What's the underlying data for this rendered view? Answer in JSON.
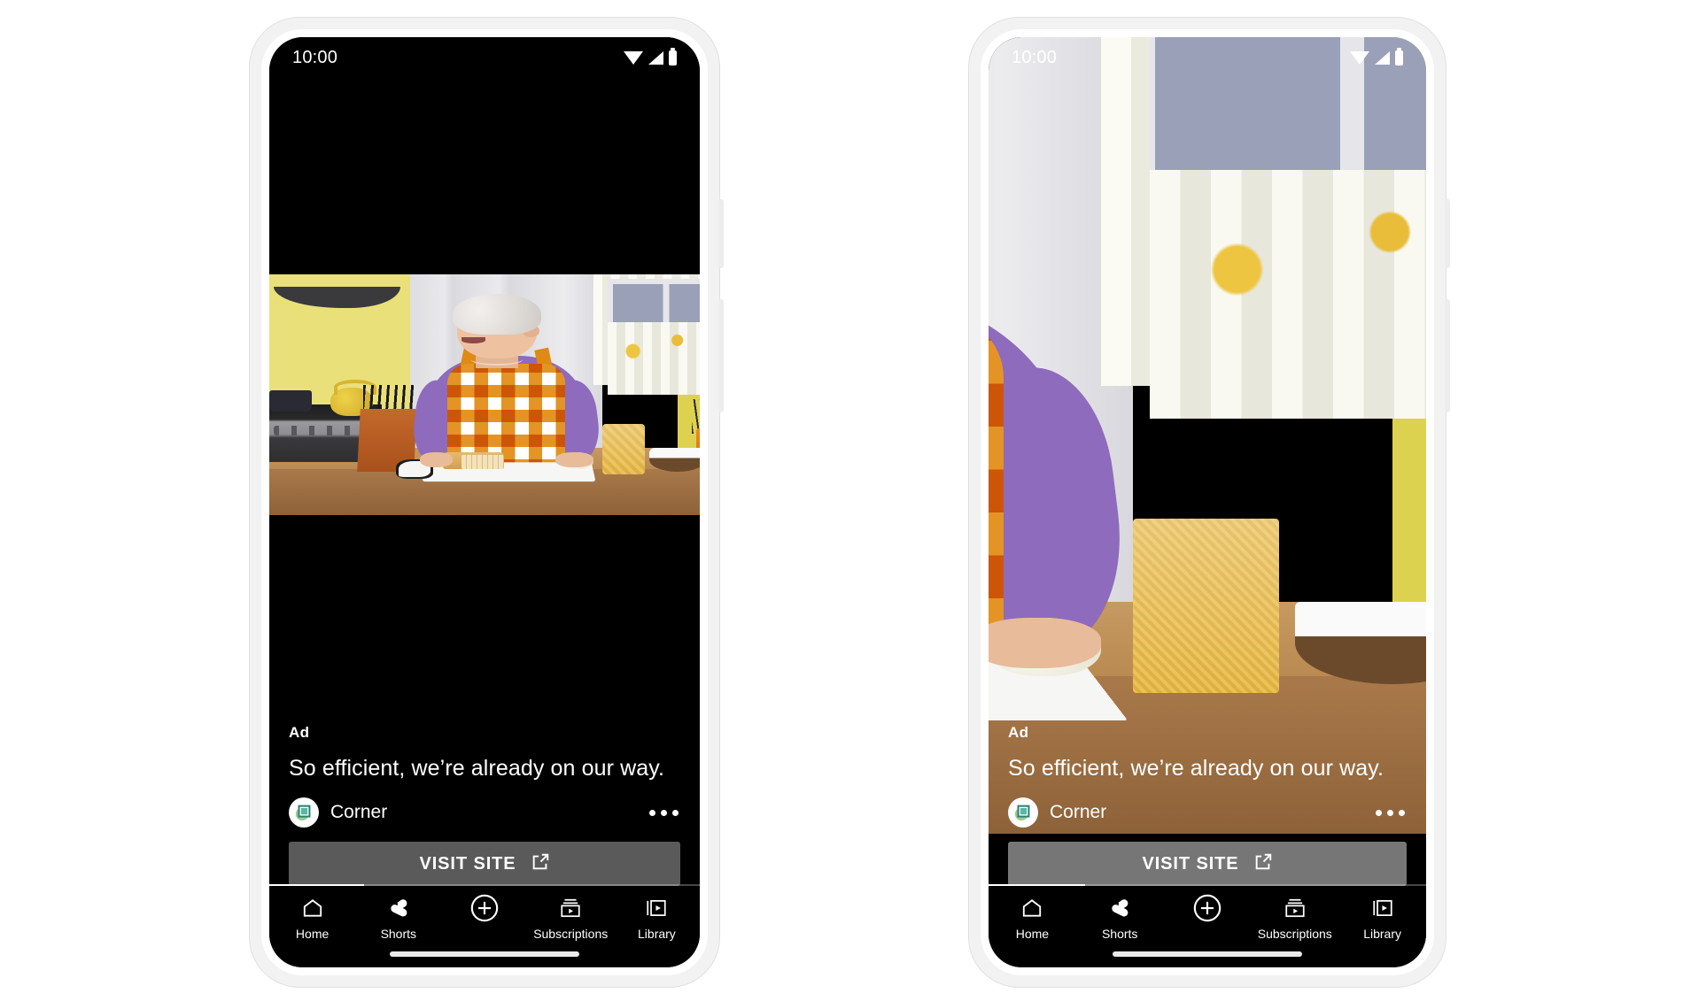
{
  "phones": [
    {
      "id": "phone-left",
      "variant": "letterboxed",
      "status": {
        "clock": "10:00",
        "icons": [
          "wifi-icon",
          "signal-icon",
          "battery-icon"
        ]
      },
      "ad": {
        "label": "Ad",
        "headline": "So efficient, we’re already on our way.",
        "brand": "Corner",
        "brand_icon": "corner-logo-icon",
        "overflow_icon": "kebab-menu-icon",
        "cta_label": "VISIT SITE",
        "cta_icon": "external-link-icon",
        "cta_style": "solid"
      },
      "video": {
        "progress_percent": 22
      },
      "nav": [
        {
          "label": "Home",
          "icon": "home-icon"
        },
        {
          "label": "Shorts",
          "icon": "shorts-icon"
        },
        {
          "label": "",
          "icon": "create-plus-icon"
        },
        {
          "label": "Subscriptions",
          "icon": "subscriptions-icon"
        },
        {
          "label": "Library",
          "icon": "library-icon"
        }
      ]
    },
    {
      "id": "phone-right",
      "variant": "fullbleed",
      "status": {
        "clock": "10:00",
        "icons": [
          "wifi-icon",
          "signal-icon",
          "battery-icon"
        ]
      },
      "ad": {
        "label": "Ad",
        "headline": "So efficient, we’re already on our way.",
        "brand": "Corner",
        "brand_icon": "corner-logo-icon",
        "overflow_icon": "kebab-menu-icon",
        "cta_label": "VISIT SITE",
        "cta_icon": "external-link-icon",
        "cta_style": "glass"
      },
      "video": {
        "progress_percent": 22
      },
      "nav": [
        {
          "label": "Home",
          "icon": "home-icon"
        },
        {
          "label": "Shorts",
          "icon": "shorts-icon"
        },
        {
          "label": "",
          "icon": "create-plus-icon"
        },
        {
          "label": "Subscriptions",
          "icon": "subscriptions-icon"
        },
        {
          "label": "Library",
          "icon": "library-icon"
        }
      ]
    }
  ],
  "colors": {
    "page_background": "#ffffff",
    "phone_frame": "#f2f2f2",
    "screen_background": "#000000",
    "cta_solid": "#5a5a5a",
    "text_primary": "#ffffff",
    "brand_apron_orange": "#e28d14",
    "brand_sweater_purple": "#8e6bbd",
    "kitchen_wall_yellow": "#e9e07a"
  }
}
